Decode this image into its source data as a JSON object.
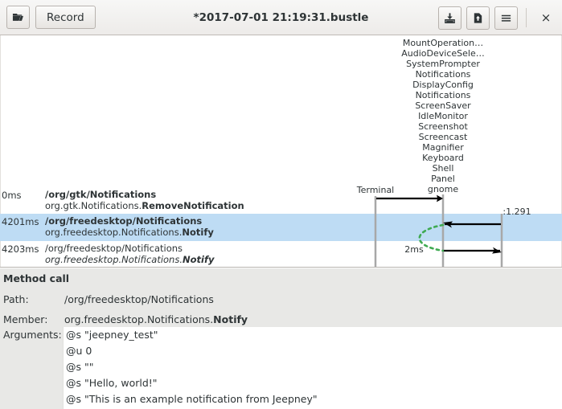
{
  "window": {
    "title": "*2017-07-01 21:19:31.bustle",
    "close_label": "×"
  },
  "toolbar": {
    "open_icon": "open-folder-icon",
    "record_label": "Record",
    "save_icon": "save-to-disk-icon",
    "export_icon": "export-file-icon",
    "menu_icon": "hamburger-menu-icon"
  },
  "diagram": {
    "lane_labels": [
      "MountOperation…",
      "AudioDeviceSele…",
      "SystemPrompter",
      "Notifications",
      "DisplayConfig",
      "Notifications",
      "ScreenSaver",
      "IdleMonitor",
      "Screenshot",
      "Screencast",
      "Magnifier",
      "Keyboard",
      "Shell",
      "Panel",
      "gnome"
    ],
    "terminal_label": "Terminal",
    "bus_name_label": ":1.291",
    "duration_label": "2ms"
  },
  "events": [
    {
      "time": "0ms",
      "path": "/org/gtk/Notifications",
      "interface": "org.gtk.Notifications.",
      "member": "RemoveNotification",
      "selected": false,
      "italic": false
    },
    {
      "time": "4201ms",
      "path": "/org/freedesktop/Notifications",
      "interface": "org.freedesktop.Notifications.",
      "member": "Notify",
      "selected": true,
      "italic": false
    },
    {
      "time": "4203ms",
      "path": "/org/freedesktop/Notifications",
      "interface": "org.freedesktop.Notifications.",
      "member": "Notify",
      "selected": false,
      "italic": true
    }
  ],
  "details": {
    "title": "Method call",
    "path_label": "Path:",
    "path_value": "/org/freedesktop/Notifications",
    "member_label": "Member:",
    "member_interface": "org.freedesktop.Notifications.",
    "member_name": "Notify",
    "arguments_label": "Arguments:",
    "arguments": [
      "@s \"jeepney_test\"",
      "@u 0",
      "@s \"\"",
      "@s \"Hello, world!\"",
      "@s \"This is an example notification from Jeepney\""
    ]
  },
  "colors": {
    "selection": "#bedcf4",
    "lifeline": "#a8a8a8",
    "arrow": "#000000",
    "return_curve": "#3faa52",
    "panel_bg": "#e8e8e6",
    "titlebar_bg": "#edebe9"
  }
}
